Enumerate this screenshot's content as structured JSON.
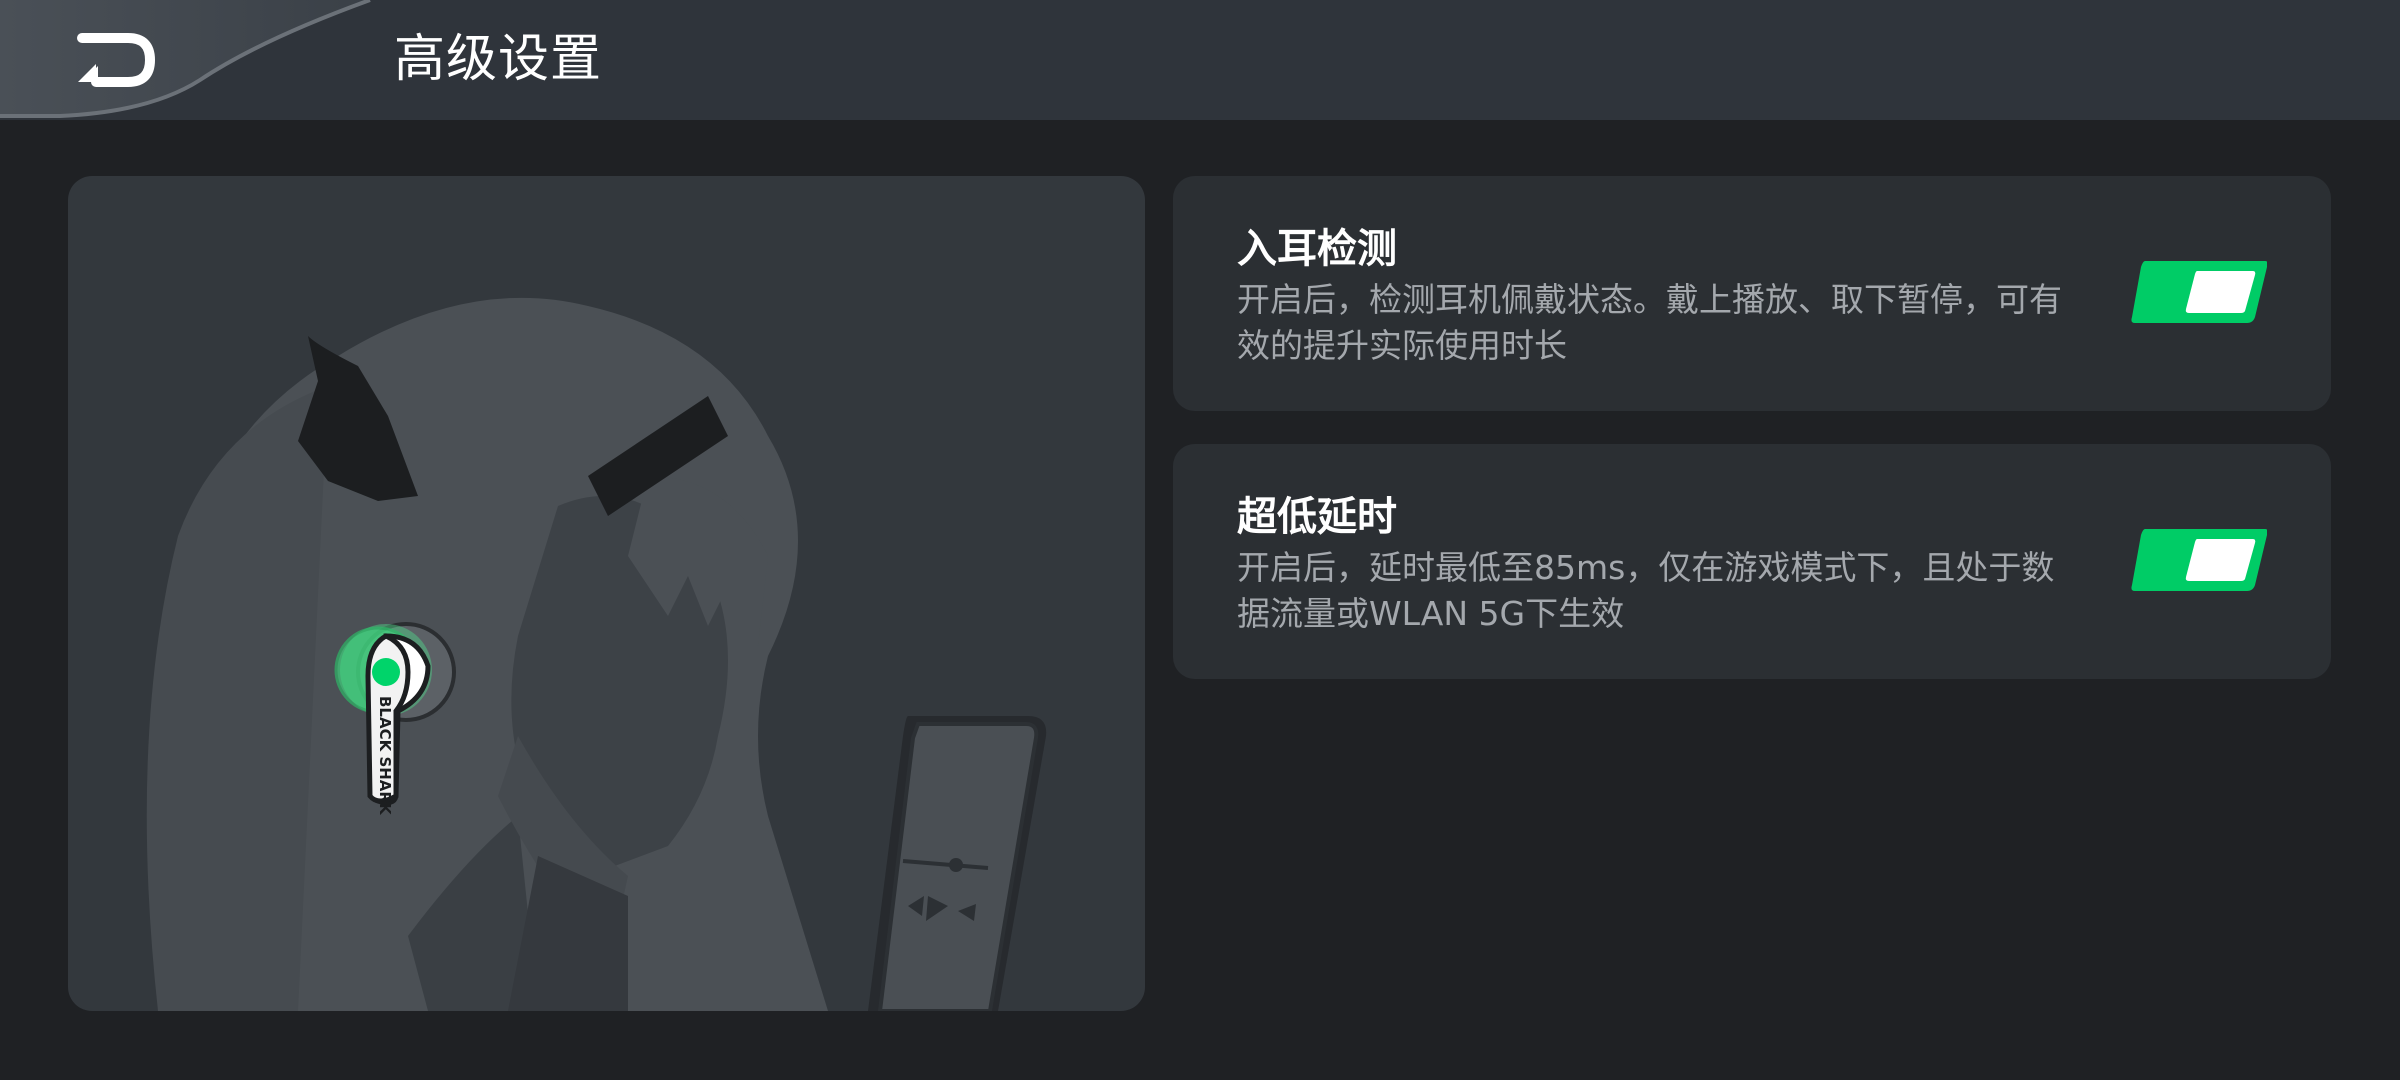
{
  "header": {
    "title": "高级设置",
    "back_icon": "back-arrow-icon"
  },
  "illustration": {
    "earbud_brand": "BLACK SHARK"
  },
  "settings": [
    {
      "title": "入耳检测",
      "description": "开启后，检测耳机佩戴状态。戴上播放、取下暂停，可有效的提升实际使用时长",
      "enabled": true
    },
    {
      "title": "超低延时",
      "description": "开启后，延时最低至85ms，仅在游戏模式下，且处于数据流量或WLAN 5G下生效",
      "enabled": true
    }
  ],
  "colors": {
    "accent": "#00cc66",
    "background": "#1f2124",
    "header": "#2f343b",
    "card": "#2b2f33"
  }
}
